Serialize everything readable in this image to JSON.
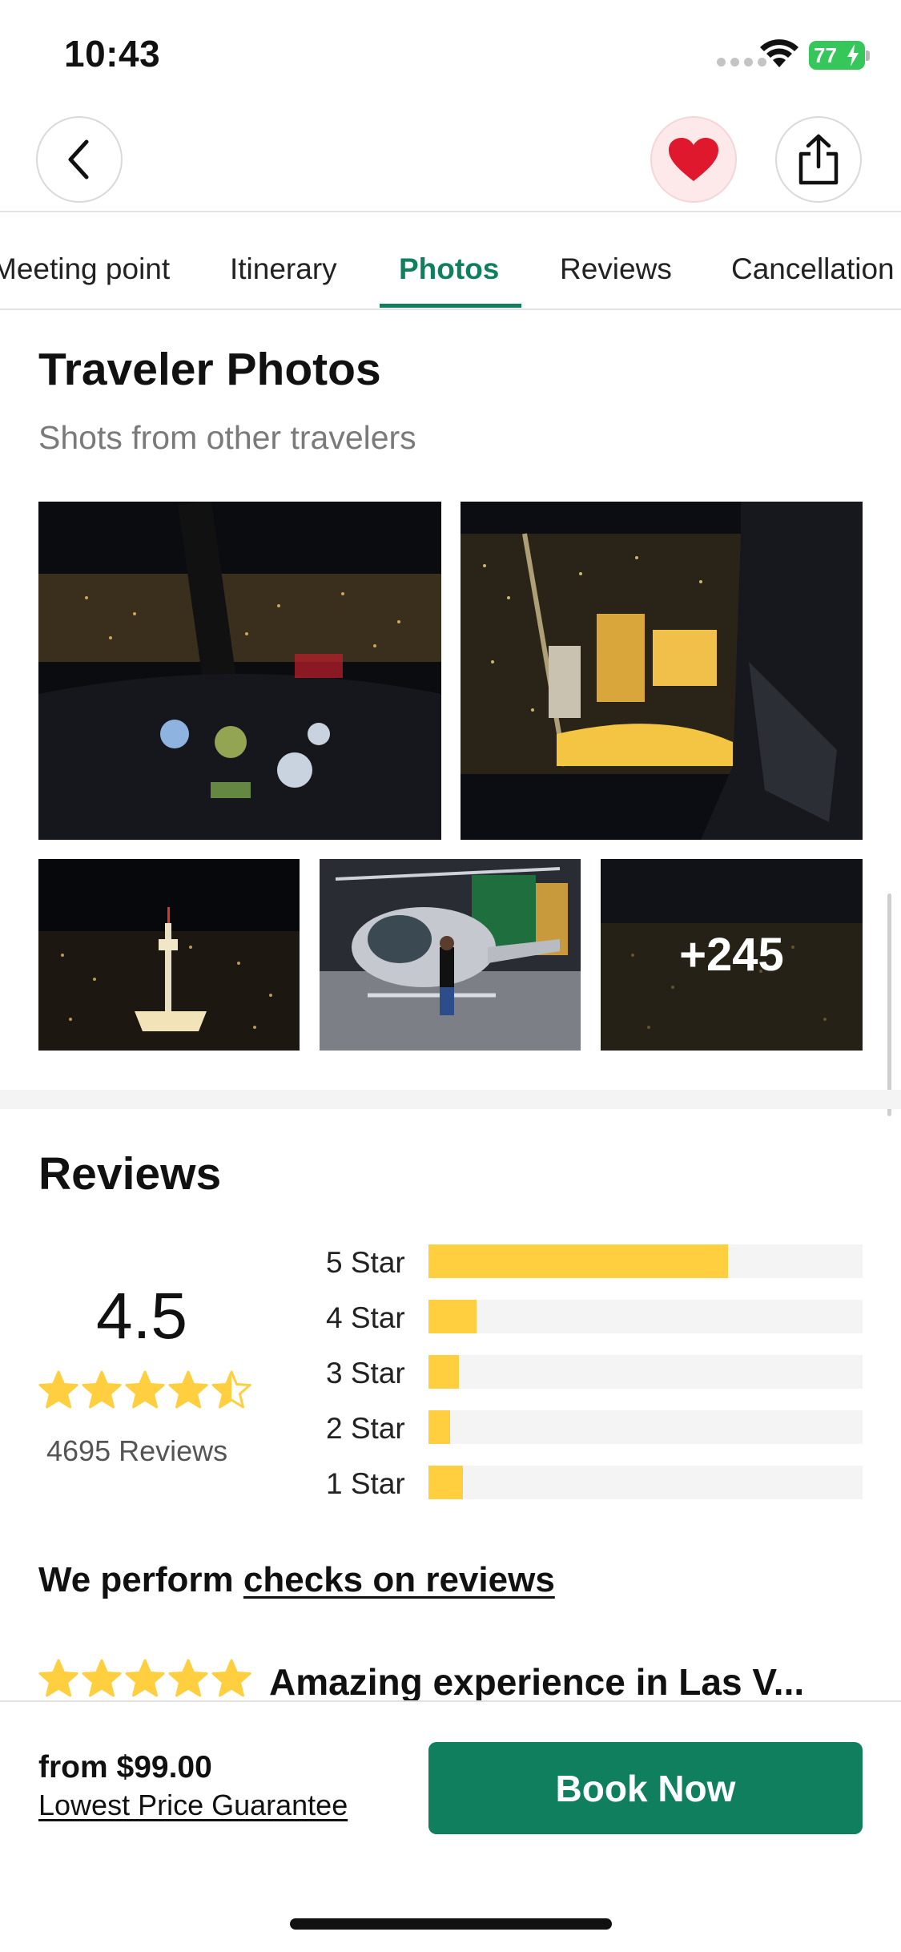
{
  "status_bar": {
    "time": "10:43",
    "battery_level": "77"
  },
  "nav": {
    "back_icon": "chevron-left-icon",
    "favorite_icon": "heart-icon",
    "share_icon": "share-icon",
    "favorite_color": "#e0182d"
  },
  "tabs": [
    {
      "label": "Meeting point",
      "active": false
    },
    {
      "label": "Itinerary",
      "active": false
    },
    {
      "label": "Photos",
      "active": true
    },
    {
      "label": "Reviews",
      "active": false
    },
    {
      "label": "Cancellation",
      "active": false
    }
  ],
  "photos_section": {
    "title": "Traveler Photos",
    "subtitle": "Shots from other travelers",
    "more_count_label": "+245"
  },
  "reviews_section": {
    "title": "Reviews",
    "average_rating": "4.5",
    "stars_value": 4.5,
    "review_count_label": "4695 Reviews",
    "histogram": [
      {
        "label": "5 Star",
        "fraction": 0.69
      },
      {
        "label": "4 Star",
        "fraction": 0.11
      },
      {
        "label": "3 Star",
        "fraction": 0.07
      },
      {
        "label": "2 Star",
        "fraction": 0.05
      },
      {
        "label": "1 Star",
        "fraction": 0.08
      }
    ],
    "checks_prefix": "We perform ",
    "checks_link": "checks on reviews",
    "first_review": {
      "stars_value": 5,
      "title": "Amazing experience in Las V..."
    }
  },
  "booking": {
    "price_label": "from $99.00",
    "guarantee_label": "Lowest Price Guarantee",
    "book_button_label": "Book Now"
  },
  "colors": {
    "accent": "#0f7f5d",
    "star": "#ffcf3f",
    "track": "#f4f4f4"
  }
}
